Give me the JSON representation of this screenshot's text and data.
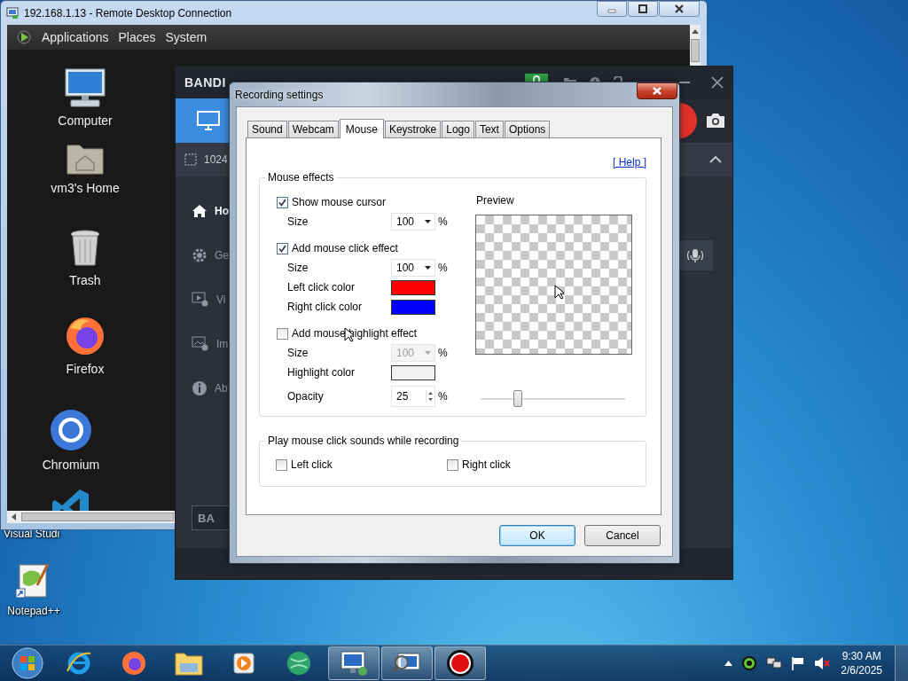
{
  "desktop": {
    "icons": [
      {
        "label": "Visual Studi",
        "kind": "covered"
      },
      {
        "label": "Notepad++",
        "kind": "notepad"
      }
    ]
  },
  "rdp_window": {
    "title": "192.168.1.13 - Remote Desktop Connection",
    "menu": [
      "Applications",
      "Places",
      "System"
    ],
    "icons": [
      {
        "label": "Computer",
        "kind": "computer"
      },
      {
        "label": "vm3's Home",
        "kind": "home"
      },
      {
        "label": "Trash",
        "kind": "trash"
      },
      {
        "label": "Firefox",
        "kind": "firefox"
      },
      {
        "label": "Chromium",
        "kind": "chromium"
      },
      {
        "kind": "vscode"
      }
    ]
  },
  "bandicam": {
    "logo": "BANDI",
    "resolution": "1024",
    "nav": [
      {
        "label": "Ho",
        "kind": "home",
        "selected": true
      },
      {
        "label": "Ge",
        "kind": "gear",
        "selected": false
      },
      {
        "label": "Vi",
        "kind": "video",
        "selected": false
      },
      {
        "label": "Im",
        "kind": "image",
        "selected": false
      },
      {
        "label": "Ab",
        "kind": "info",
        "selected": false
      }
    ],
    "footer_button": "BA"
  },
  "dialog": {
    "title": "Recording settings",
    "tabs": [
      {
        "label": "Sound",
        "selected": false
      },
      {
        "label": "Webcam",
        "selected": false
      },
      {
        "label": "Mouse",
        "selected": true
      },
      {
        "label": "Keystroke",
        "selected": false
      },
      {
        "label": "Logo",
        "selected": false
      },
      {
        "label": "Text",
        "selected": false
      },
      {
        "label": "Options",
        "selected": false
      }
    ],
    "help": "[ Help ]",
    "mouse_effects": {
      "title": "Mouse effects",
      "rows": [
        {
          "kind": "checkbox",
          "label": "Show mouse cursor",
          "checked": true
        },
        {
          "kind": "dropdown",
          "label": "Size",
          "value": "100",
          "unit": "%",
          "disabled": false
        },
        {
          "kind": "checkbox",
          "label": "Add mouse click effect",
          "checked": true
        },
        {
          "kind": "dropdown",
          "label": "Size",
          "value": "100",
          "unit": "%",
          "disabled": false
        },
        {
          "kind": "color",
          "label": "Left click color",
          "color": "#ff0000"
        },
        {
          "kind": "color",
          "label": "Right click color",
          "color": "#0000ff"
        },
        {
          "kind": "checkbox",
          "label": "Add mouse highlight effect",
          "checked": false
        },
        {
          "kind": "dropdown",
          "label": "Size",
          "value": "100",
          "unit": "%",
          "disabled": true
        },
        {
          "kind": "color",
          "label": "Highlight color",
          "color": "#f0f0f0"
        },
        {
          "kind": "spinner",
          "label": "Opacity",
          "value": "25",
          "unit": "%",
          "level": 0.26
        }
      ]
    },
    "preview": {
      "title": "Preview"
    },
    "click_sounds": {
      "title": "Play mouse click sounds while recording",
      "options": [
        {
          "label": "Left click",
          "checked": false
        },
        {
          "label": "Right click",
          "checked": false
        }
      ]
    },
    "buttons": [
      {
        "label": "OK",
        "default": true
      },
      {
        "label": "Cancel",
        "default": false
      }
    ]
  },
  "taskbar": {
    "apps": [
      {
        "kind": "ie",
        "running": false
      },
      {
        "kind": "firefox",
        "running": false
      },
      {
        "kind": "explorer",
        "running": false
      },
      {
        "kind": "media",
        "running": false
      },
      {
        "kind": "globe",
        "running": false
      },
      {
        "kind": "rdp",
        "running": true
      },
      {
        "kind": "magnifier",
        "running": true
      },
      {
        "kind": "record",
        "running": true
      }
    ],
    "time": "9:30 AM",
    "date": "2/6/2025"
  }
}
